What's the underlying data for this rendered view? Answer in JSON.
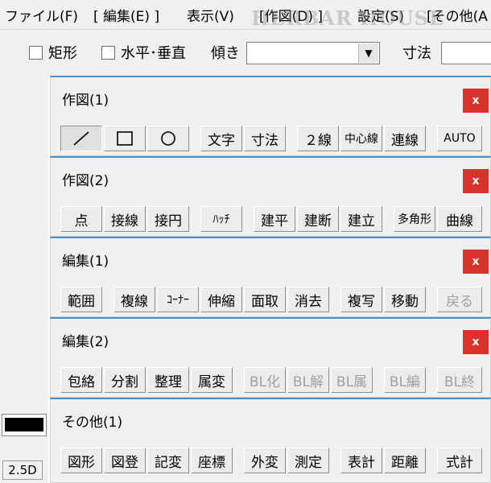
{
  "menubar": {
    "items": [
      "ファイル(F)",
      "[ 編集(E) ]",
      "表示(V)",
      "[作図(D) ]",
      "設定(S)",
      "[その他(A"
    ]
  },
  "watermark": "HERBAR HOUSE",
  "optionbar": {
    "rect_label": "矩形",
    "hv_label": "水平･垂直",
    "tilt_label": "傾き",
    "tilt_value": "",
    "dim_label": "寸法"
  },
  "leftstrip": {
    "view_button": "2.5D"
  },
  "panels": [
    {
      "title": "作図(1)",
      "close": "x",
      "buttons": [
        {
          "label": "",
          "icon": "line-icon",
          "state": "active"
        },
        {
          "label": "",
          "icon": "rectangle-icon",
          "state": "normal"
        },
        {
          "label": "",
          "icon": "circle-icon",
          "state": "normal"
        },
        {
          "label": "文字",
          "state": "normal"
        },
        {
          "label": "寸法",
          "state": "normal"
        },
        {
          "label": "２線",
          "state": "normal"
        },
        {
          "label": "中心線",
          "state": "normal"
        },
        {
          "label": "連線",
          "state": "normal"
        },
        {
          "label": "AUTO",
          "state": "normal"
        }
      ]
    },
    {
      "title": "作図(2)",
      "close": "x",
      "buttons": [
        {
          "label": "点",
          "state": "normal"
        },
        {
          "label": "接線",
          "state": "normal"
        },
        {
          "label": "接円",
          "state": "normal"
        },
        {
          "label": "ﾊｯﾁ",
          "state": "normal"
        },
        {
          "label": "建平",
          "state": "normal"
        },
        {
          "label": "建断",
          "state": "normal"
        },
        {
          "label": "建立",
          "state": "normal"
        },
        {
          "label": "多角形",
          "state": "normal"
        },
        {
          "label": "曲線",
          "state": "normal"
        }
      ]
    },
    {
      "title": "編集(1)",
      "close": "x",
      "buttons": [
        {
          "label": "範囲",
          "state": "normal"
        },
        {
          "label": "複線",
          "state": "normal"
        },
        {
          "label": "ｺｰﾅｰ",
          "state": "normal"
        },
        {
          "label": "伸縮",
          "state": "normal"
        },
        {
          "label": "面取",
          "state": "normal"
        },
        {
          "label": "消去",
          "state": "normal"
        },
        {
          "label": "複写",
          "state": "normal"
        },
        {
          "label": "移動",
          "state": "normal"
        },
        {
          "label": "戻る",
          "state": "disabled"
        }
      ]
    },
    {
      "title": "編集(2)",
      "close": "x",
      "buttons": [
        {
          "label": "包絡",
          "state": "normal"
        },
        {
          "label": "分割",
          "state": "normal"
        },
        {
          "label": "整理",
          "state": "normal"
        },
        {
          "label": "属変",
          "state": "normal"
        },
        {
          "label": "BL化",
          "state": "disabled"
        },
        {
          "label": "BL解",
          "state": "disabled"
        },
        {
          "label": "BL属",
          "state": "disabled"
        },
        {
          "label": "BL編",
          "state": "disabled"
        },
        {
          "label": "BL終",
          "state": "disabled"
        }
      ]
    },
    {
      "title": "その他(1)",
      "close": "",
      "buttons": [
        {
          "label": "図形",
          "state": "normal"
        },
        {
          "label": "図登",
          "state": "normal"
        },
        {
          "label": "記変",
          "state": "normal"
        },
        {
          "label": "座標",
          "state": "normal"
        },
        {
          "label": "外変",
          "state": "normal"
        },
        {
          "label": "測定",
          "state": "normal"
        },
        {
          "label": "表計",
          "state": "normal"
        },
        {
          "label": "距離",
          "state": "normal"
        },
        {
          "label": "式計",
          "state": "normal"
        }
      ]
    }
  ],
  "colors": {
    "close_button": "#d9322a",
    "panel_border": "#4a90c8",
    "disabled_text": "#a0a0a0"
  }
}
